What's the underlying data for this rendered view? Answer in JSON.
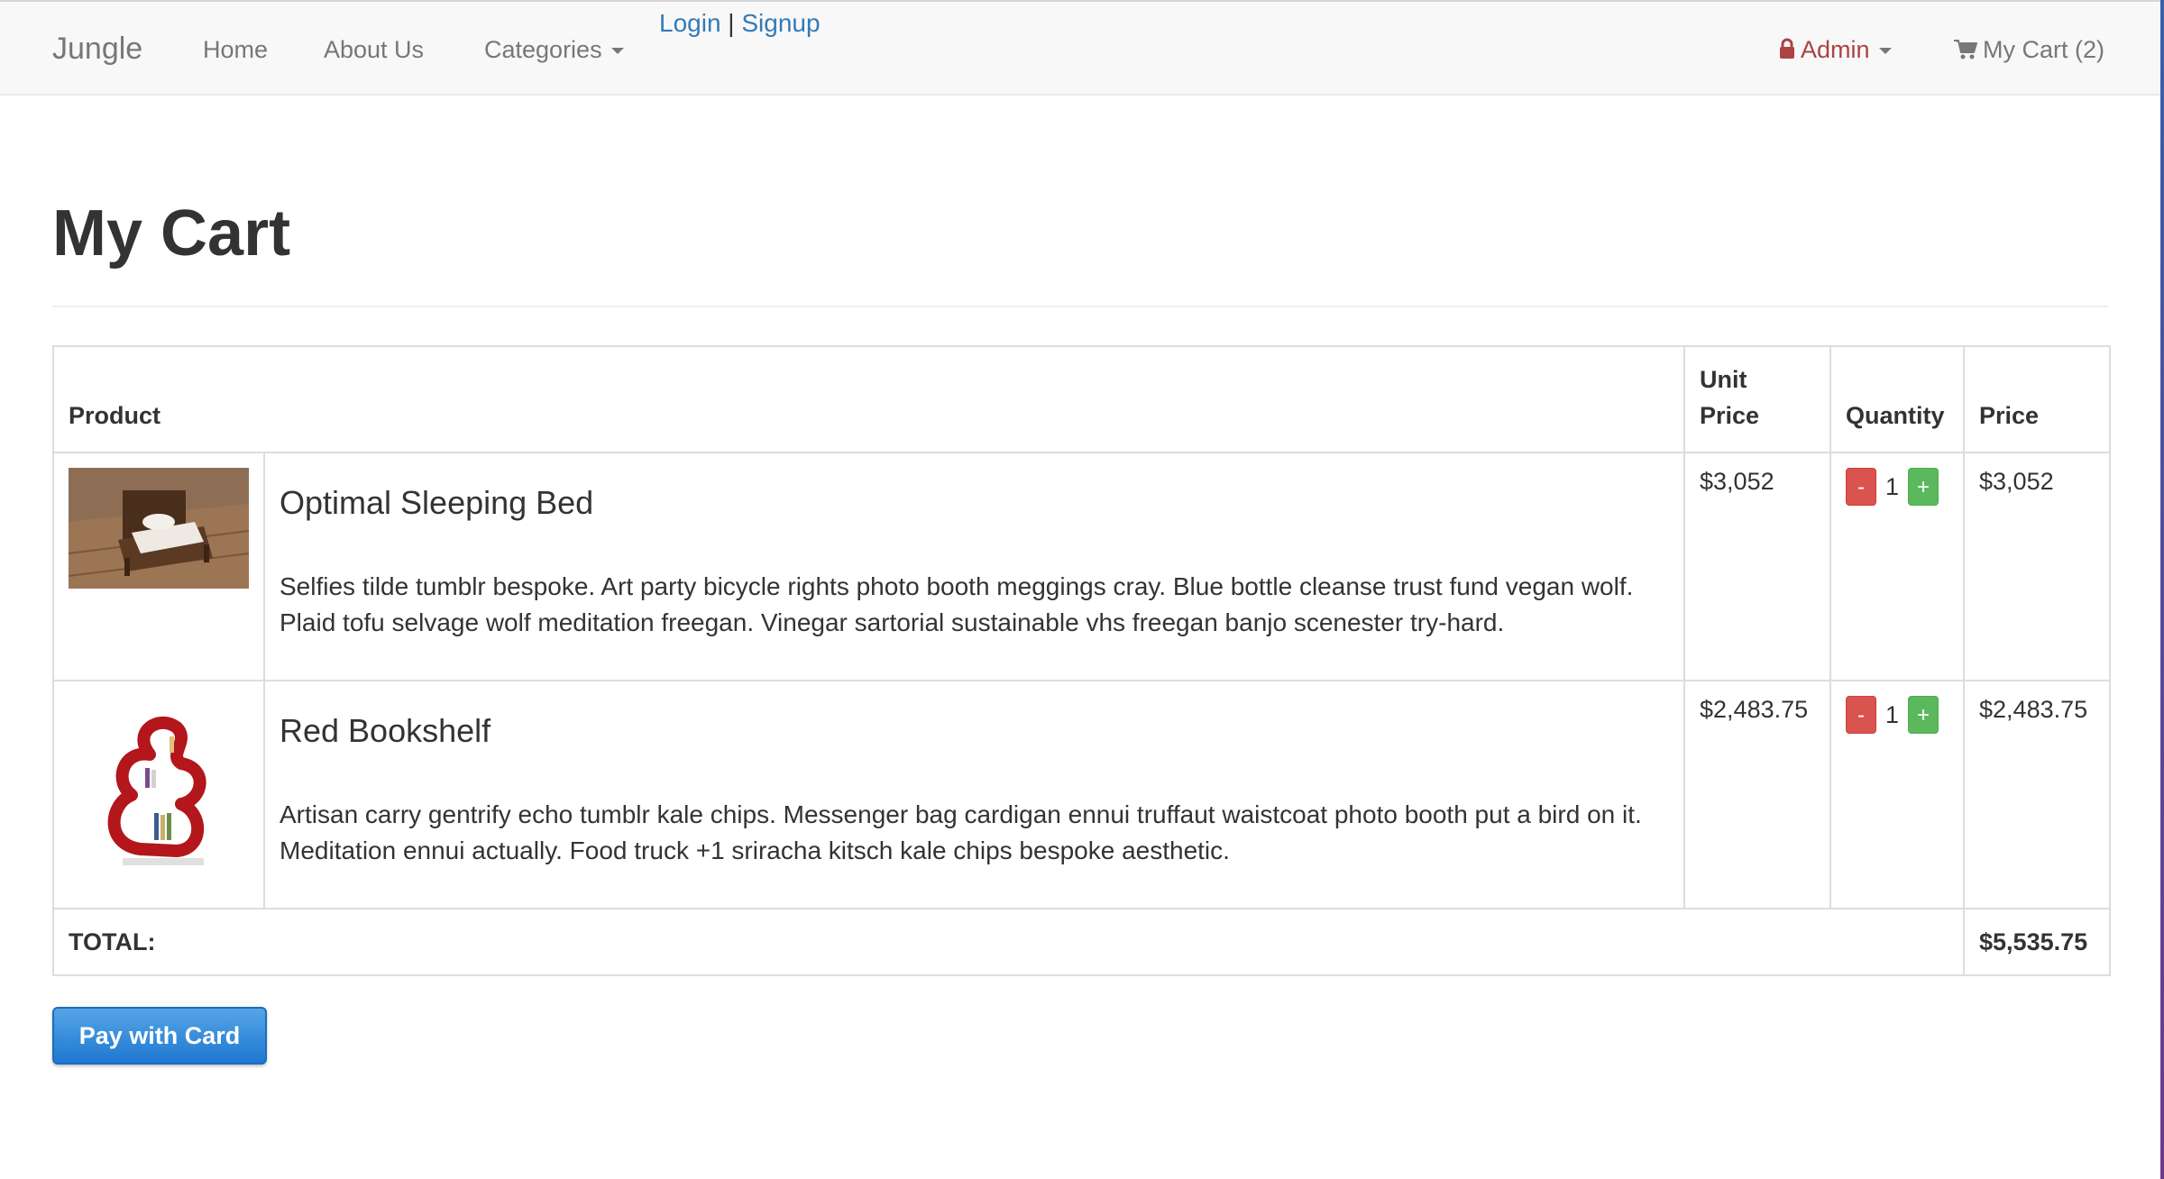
{
  "navbar": {
    "brand": "Jungle",
    "home": "Home",
    "about": "About Us",
    "categories": "Categories",
    "login": "Login",
    "separator": "|",
    "signup": "Signup",
    "admin": "Admin",
    "cart": "My Cart (2)"
  },
  "page": {
    "title": "My Cart"
  },
  "table": {
    "headers": {
      "product": "Product",
      "unit_price_line1": "Unit",
      "unit_price_line2": "Price",
      "quantity": "Quantity",
      "price": "Price"
    },
    "items": [
      {
        "name": "Optimal Sleeping Bed",
        "description": "Selfies tilde tumblr bespoke. Art party bicycle rights photo booth meggings cray. Blue bottle cleanse trust fund vegan wolf. Plaid tofu selvage wolf meditation freegan. Vinegar sartorial sustainable vhs freegan banjo scenester try-hard.",
        "unit_price": "$3,052",
        "quantity": "1",
        "price": "$3,052",
        "minus": "-",
        "plus": "+"
      },
      {
        "name": "Red Bookshelf",
        "description": "Artisan carry gentrify echo tumblr kale chips. Messenger bag cardigan ennui truffaut waistcoat photo booth put a bird on it. Meditation ennui actually. Food truck +1 sriracha kitsch kale chips bespoke aesthetic.",
        "unit_price": "$2,483.75",
        "quantity": "1",
        "price": "$2,483.75",
        "minus": "-",
        "plus": "+"
      }
    ],
    "total_label": "TOTAL:",
    "total_value": "$5,535.75"
  },
  "pay_button": "Pay with Card",
  "colors": {
    "link": "#337ab7",
    "admin": "#a94442",
    "minus_button": "#d9534f",
    "plus_button": "#5cb85c",
    "pay_button": "#2b86d8"
  },
  "icons": {
    "admin": "lock-icon",
    "cart": "shopping-cart-icon",
    "dropdown": "caret-down-icon"
  }
}
